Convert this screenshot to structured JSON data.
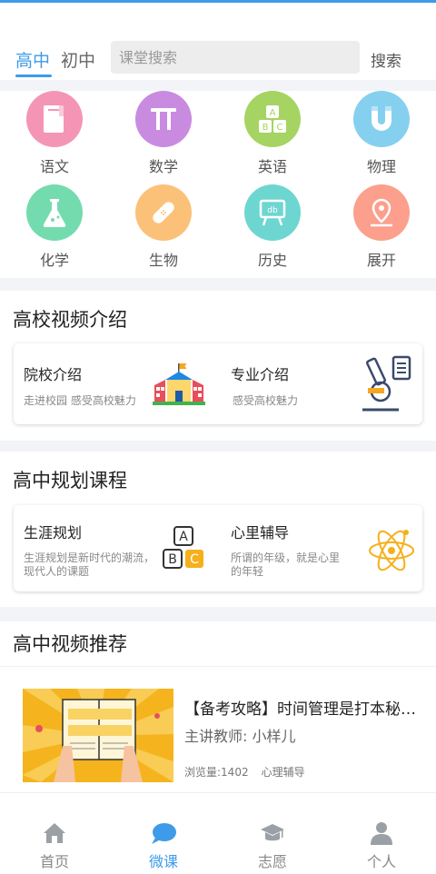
{
  "header": {
    "tabs": [
      {
        "label": "高中",
        "active": true
      },
      {
        "label": "初中",
        "active": false
      }
    ],
    "search_placeholder": "课堂搜索",
    "search_button": "搜索"
  },
  "categories": [
    {
      "label": "语文",
      "icon": "book-icon",
      "color": "#f595b6"
    },
    {
      "label": "数学",
      "icon": "pi-icon",
      "color": "#c98be0"
    },
    {
      "label": "英语",
      "icon": "abc-blocks-icon",
      "color": "#a5d462"
    },
    {
      "label": "物理",
      "icon": "magnet-icon",
      "color": "#86d0ef"
    },
    {
      "label": "化学",
      "icon": "flask-icon",
      "color": "#74dbae"
    },
    {
      "label": "生物",
      "icon": "bandage-icon",
      "color": "#fcc179"
    },
    {
      "label": "历史",
      "icon": "easel-icon",
      "color": "#6ed6d1"
    },
    {
      "label": "展开",
      "icon": "map-pin-icon",
      "color": "#fc9f8c"
    }
  ],
  "college_section": {
    "title": "高校视频介绍",
    "items": [
      {
        "title": "院校介绍",
        "desc": "走进校园 感受高校魅力",
        "icon": "school-building-icon"
      },
      {
        "title": "专业介绍",
        "desc": "感受高校魅力",
        "icon": "microscope-icon"
      }
    ]
  },
  "planning_section": {
    "title": "高中规划课程",
    "items": [
      {
        "title": "生涯规划",
        "desc": "生涯规划是新时代的潮流，现代人的课题",
        "icon": "abc-icon"
      },
      {
        "title": "心里辅导",
        "desc": "所谓的年级，就是心里的年轻",
        "icon": "atom-icon"
      }
    ]
  },
  "recommend_section": {
    "title": "高中视频推荐",
    "video": {
      "title": "【备考攻略】时间管理是打本秘籍...",
      "teacher": "主讲教师: 小样儿",
      "views": "浏览量:1402",
      "tag": "心理辅导"
    }
  },
  "bottom_nav": [
    {
      "label": "首页",
      "icon": "home-icon",
      "active": false
    },
    {
      "label": "微课",
      "icon": "chat-bubble-icon",
      "active": true
    },
    {
      "label": "志愿",
      "icon": "graduation-cap-icon",
      "active": false
    },
    {
      "label": "个人",
      "icon": "person-icon",
      "active": false
    }
  ],
  "colors": {
    "accent": "#3d9be9",
    "divider": "#f2f4f7"
  }
}
